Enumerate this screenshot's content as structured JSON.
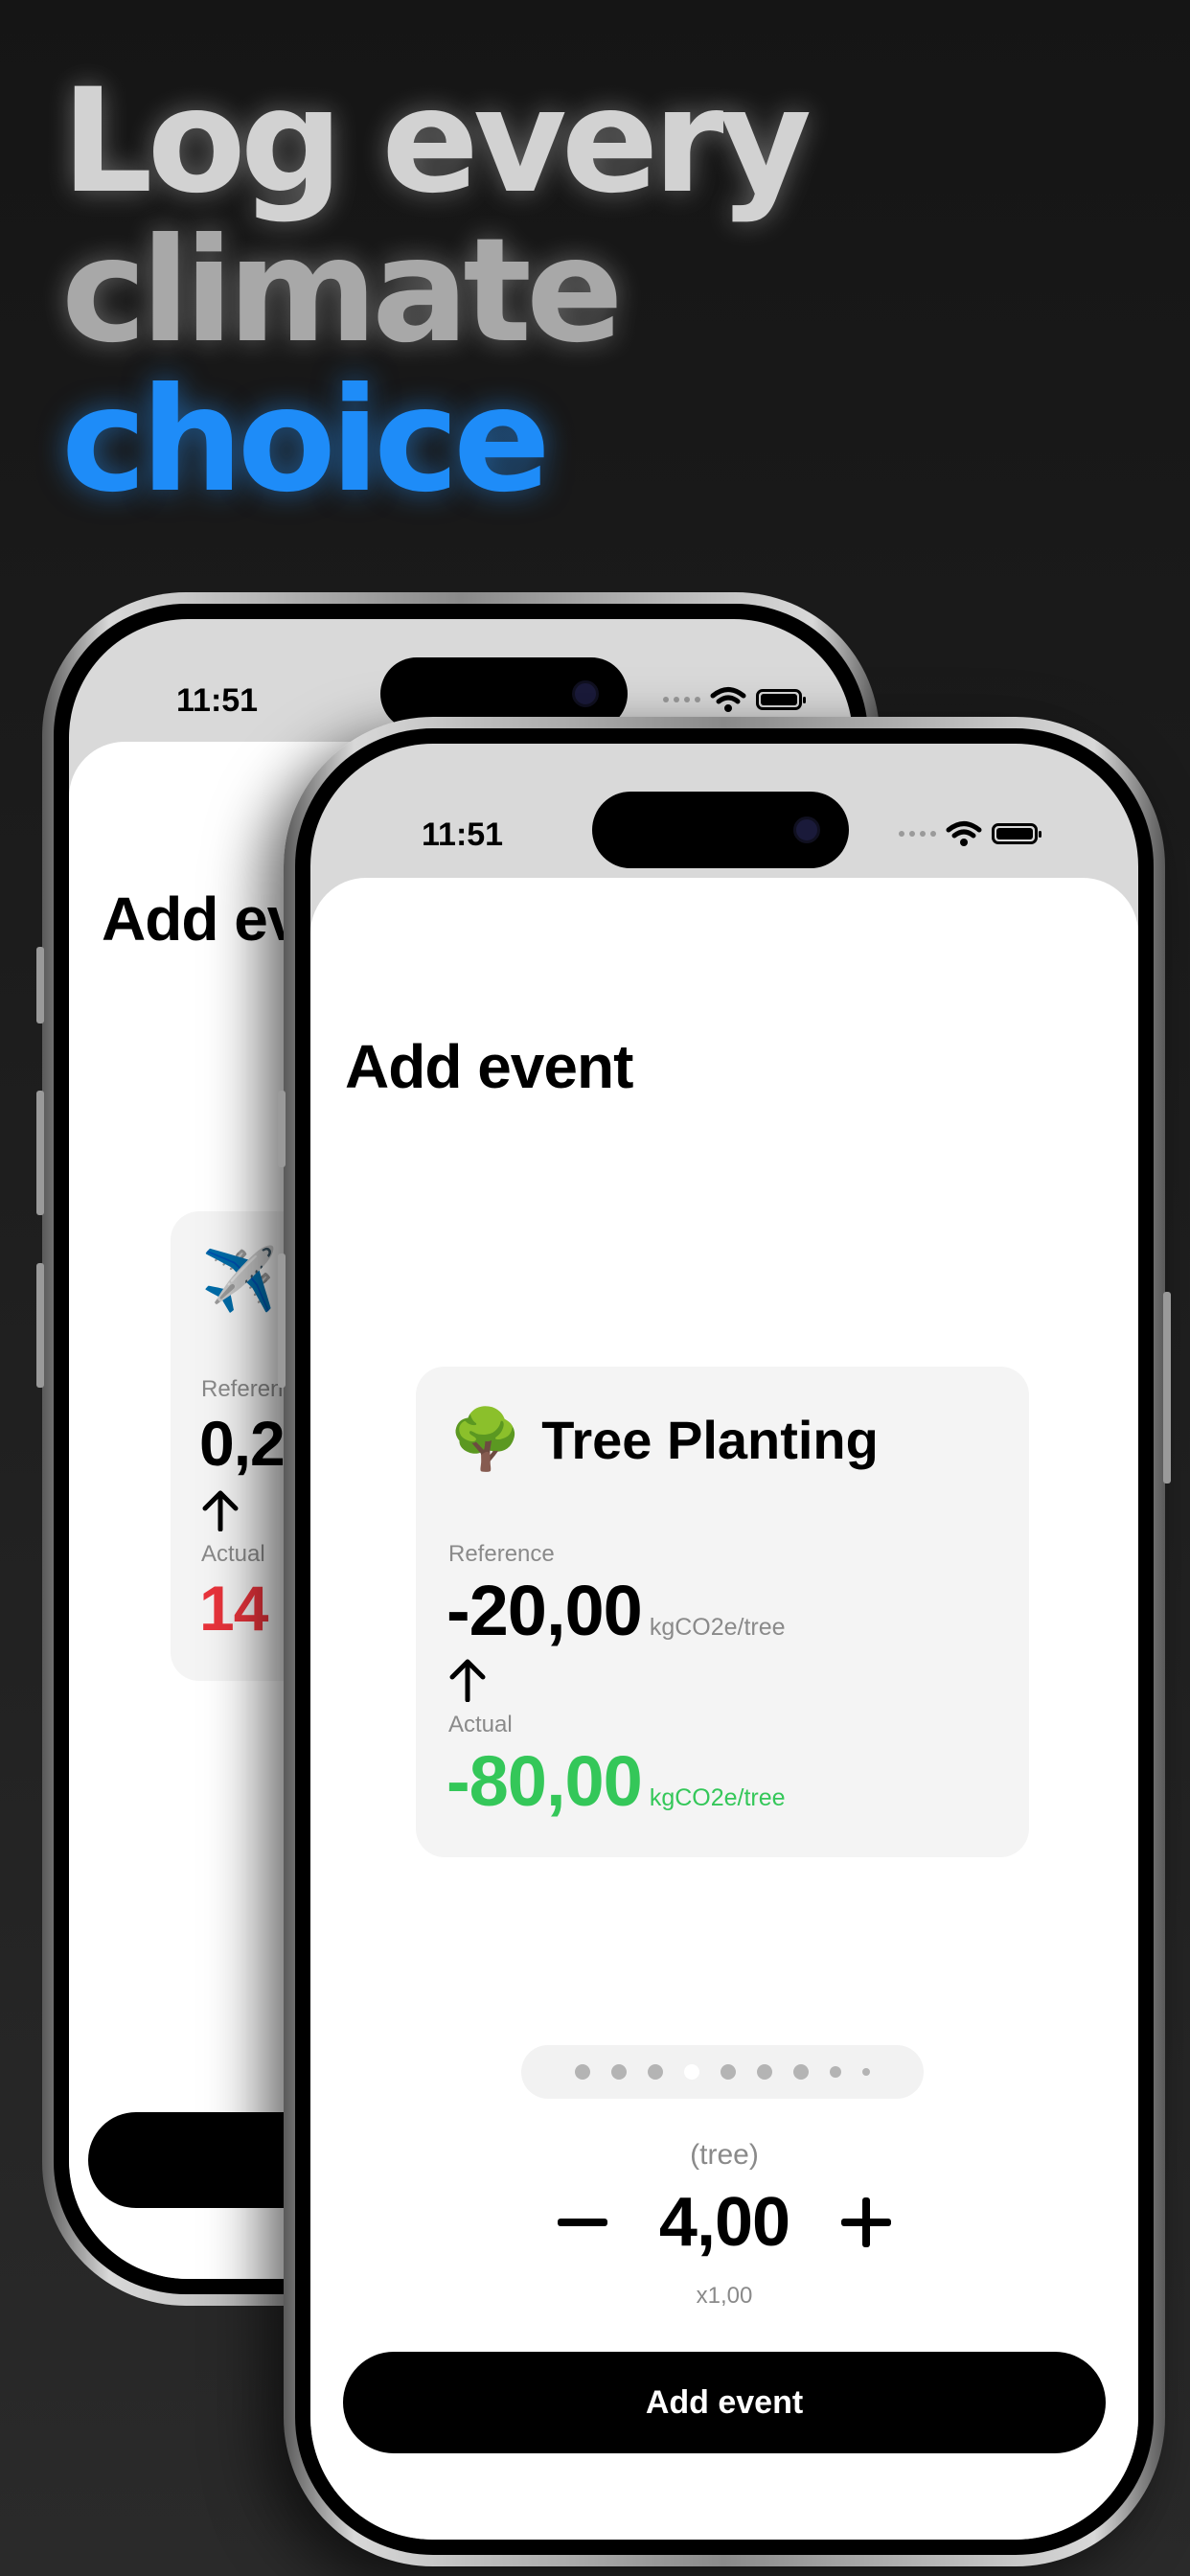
{
  "headline": {
    "line1": "Log every",
    "line2": "climate",
    "line3": "choice"
  },
  "colors": {
    "accent_blue": "#1E8CF8",
    "positive_green": "#34C759",
    "negative_red": "#E8333B"
  },
  "back_phone": {
    "status_time": "11:51",
    "sheet_title": "Add ev",
    "event": {
      "icon": "airplane-icon",
      "emoji": "✈️",
      "reference_label": "Referen",
      "reference_value": "0,2",
      "actual_label": "Actual",
      "actual_value": "14"
    }
  },
  "front_phone": {
    "status_time": "11:51",
    "sheet_title": "Add event",
    "event": {
      "icon": "tree-icon",
      "emoji": "🌳",
      "name": "Tree Planting",
      "reference_label": "Reference",
      "reference_value": "-20,00",
      "reference_unit": "kgCO2e/tree",
      "actual_label": "Actual",
      "actual_value": "-80,00",
      "actual_unit": "kgCO2e/tree"
    },
    "pager": {
      "page_count": 9,
      "active_index": 3
    },
    "quantity": {
      "unit": "(tree)",
      "value": "4,00",
      "multiplier": "x1,00"
    },
    "add_button_label": "Add event"
  }
}
